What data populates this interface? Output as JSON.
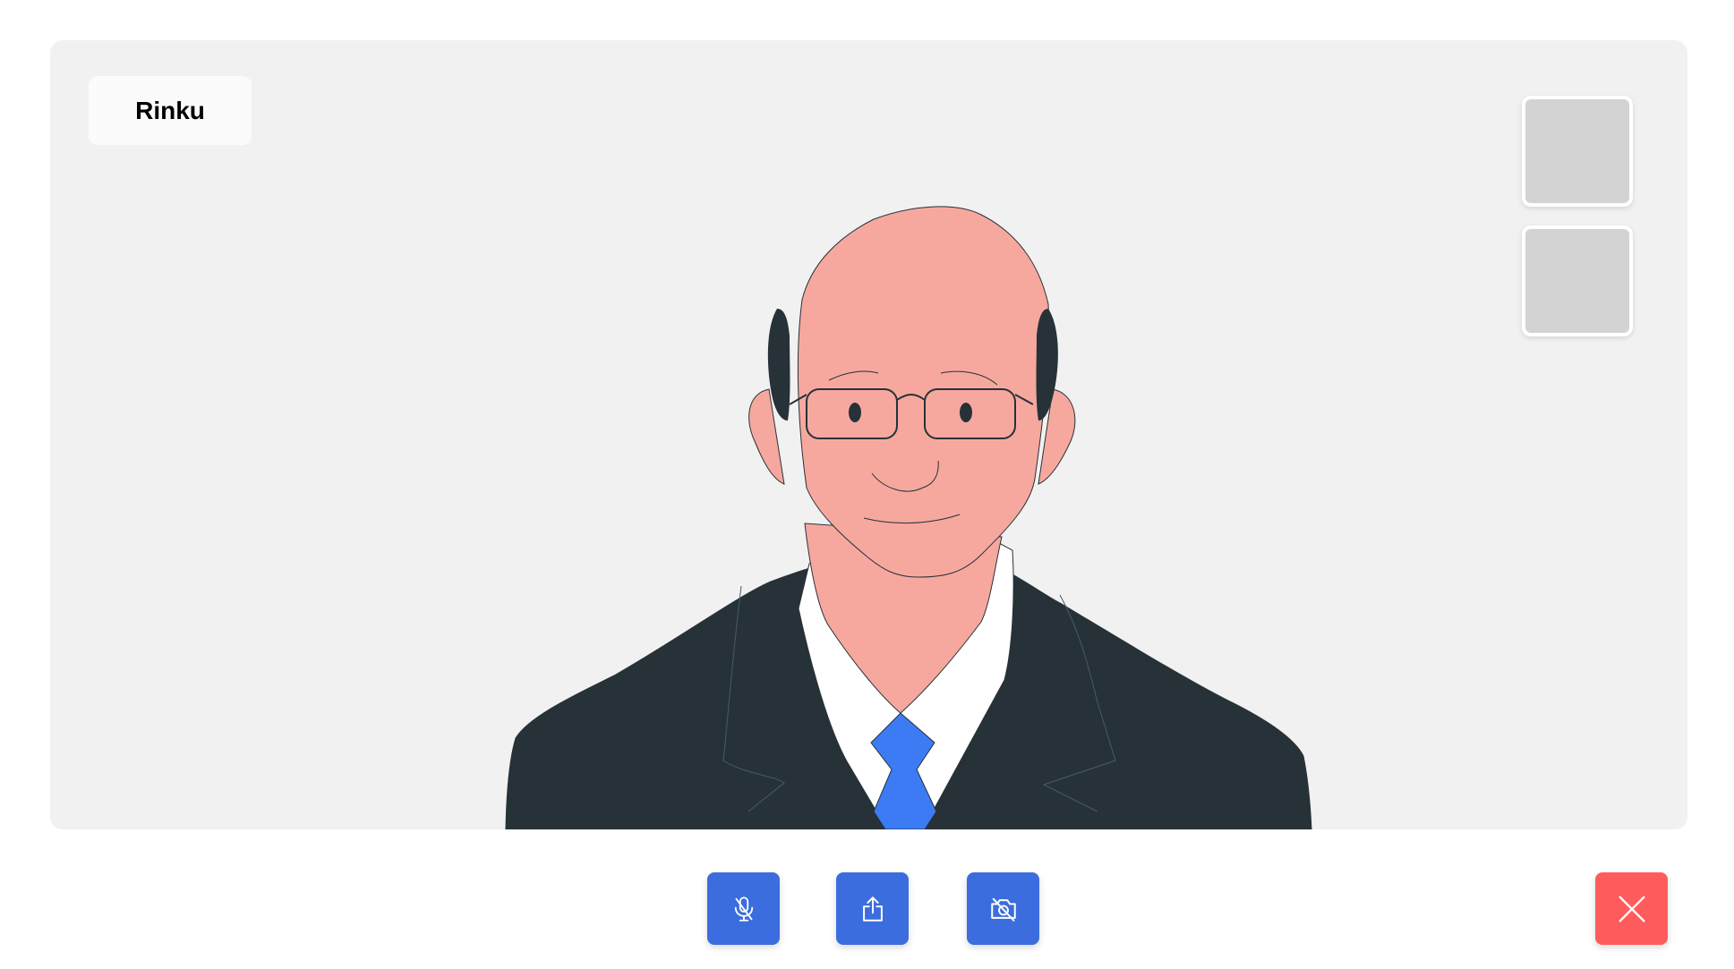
{
  "participant": {
    "name": "Rinku"
  },
  "self_view": {
    "thumbnails": [
      "thumb-1",
      "thumb-2"
    ]
  },
  "controls": {
    "mute_icon": "mic-off-icon",
    "share_icon": "share-upload-icon",
    "camera_icon": "camera-off-icon",
    "end_icon": "close-icon"
  },
  "colors": {
    "stage_bg": "#f1f1f1",
    "control_blue": "#3b6ddf",
    "end_red": "#fe5c5c",
    "skin": "#f6a89f",
    "suit": "#263238",
    "tie": "#3d7bf5"
  }
}
